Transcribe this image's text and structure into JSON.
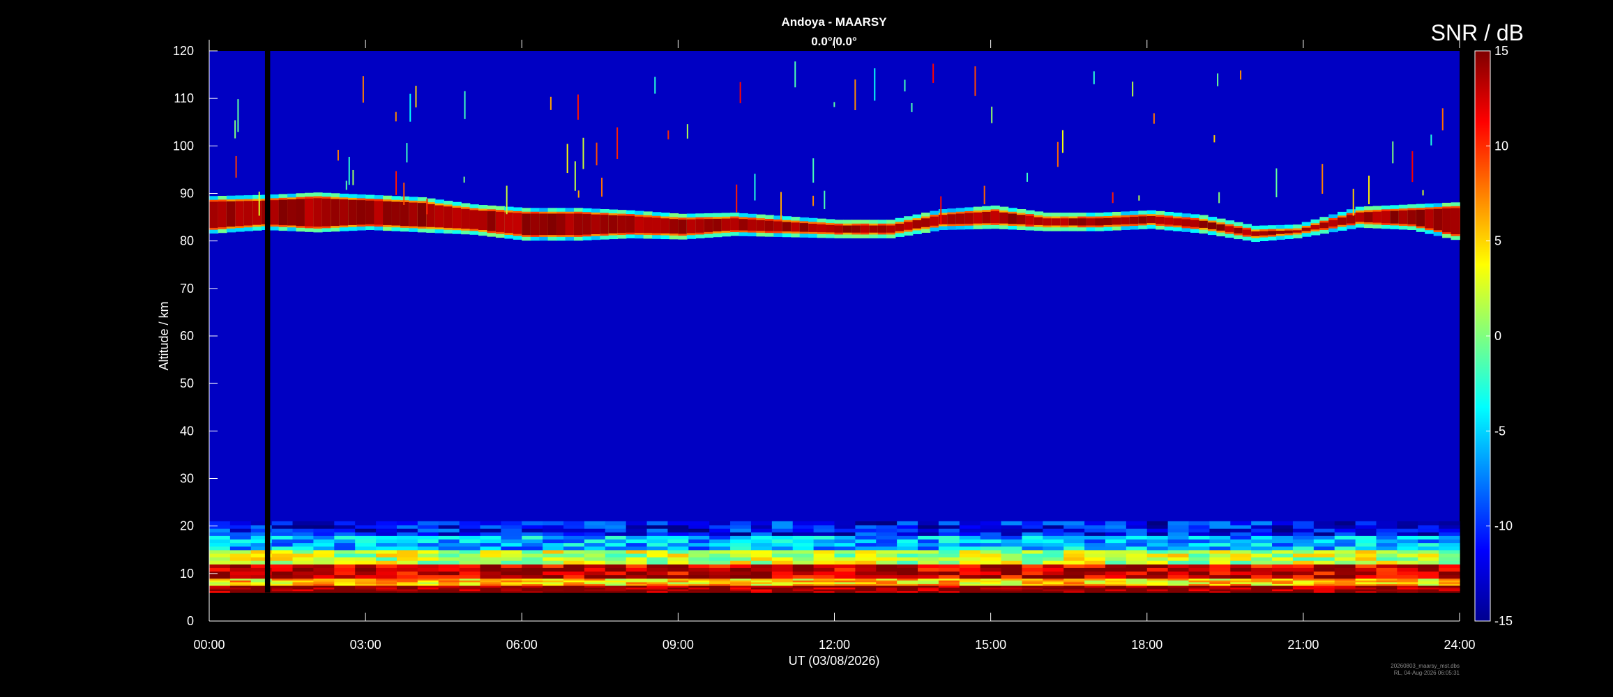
{
  "chart_data": {
    "type": "heatmap",
    "title": "Andoya - MAARSY",
    "subtitle": "0.0°/0.0°",
    "xlabel": "UT (03/08/2026)",
    "ylabel": "Altitude / km",
    "colorbar_label": "SNR / dB",
    "x_ticks": [
      "00:00",
      "03:00",
      "06:00",
      "09:00",
      "12:00",
      "15:00",
      "18:00",
      "21:00",
      "24:00"
    ],
    "x_range_hours": [
      0,
      24
    ],
    "y_ticks": [
      0,
      10,
      20,
      30,
      40,
      50,
      60,
      70,
      80,
      90,
      100,
      110,
      120
    ],
    "ylim": [
      0,
      120
    ],
    "data_altitude_range_km": [
      6,
      120
    ],
    "colorbar_ticks": [
      15,
      10,
      5,
      0,
      -5,
      -10,
      -15
    ],
    "clim": [
      -15,
      15
    ],
    "colormap": "jet",
    "background_snr_db": -13,
    "data_gap": {
      "start_hour": 1.07,
      "end_hour": 1.17
    },
    "features": [
      {
        "name": "PMSE layer",
        "snr_db": 15,
        "segments": [
          {
            "t": 0.0,
            "center_km": 85.5,
            "thickness_km": 5.5
          },
          {
            "t": 1.0,
            "center_km": 86.0,
            "thickness_km": 5.0
          },
          {
            "t": 2.0,
            "center_km": 86.0,
            "thickness_km": 6.0
          },
          {
            "t": 3.0,
            "center_km": 86.0,
            "thickness_km": 5.0
          },
          {
            "t": 4.0,
            "center_km": 85.5,
            "thickness_km": 5.0
          },
          {
            "t": 5.0,
            "center_km": 84.5,
            "thickness_km": 4.0
          },
          {
            "t": 6.0,
            "center_km": 83.5,
            "thickness_km": 4.5
          },
          {
            "t": 7.0,
            "center_km": 83.5,
            "thickness_km": 4.5
          },
          {
            "t": 8.0,
            "center_km": 83.5,
            "thickness_km": 3.5
          },
          {
            "t": 9.0,
            "center_km": 83.0,
            "thickness_km": 3.0
          },
          {
            "t": 10.0,
            "center_km": 83.5,
            "thickness_km": 2.5
          },
          {
            "t": 11.0,
            "center_km": 83.0,
            "thickness_km": 2.0
          },
          {
            "t": 12.0,
            "center_km": 82.5,
            "thickness_km": 1.5
          },
          {
            "t": 13.0,
            "center_km": 82.5,
            "thickness_km": 1.5
          },
          {
            "t": 14.0,
            "center_km": 84.5,
            "thickness_km": 2.0
          },
          {
            "t": 15.0,
            "center_km": 85.0,
            "thickness_km": 2.5
          },
          {
            "t": 16.0,
            "center_km": 84.0,
            "thickness_km": 1.5
          },
          {
            "t": 17.0,
            "center_km": 84.0,
            "thickness_km": 1.5
          },
          {
            "t": 18.0,
            "center_km": 84.5,
            "thickness_km": 1.5
          },
          {
            "t": 19.0,
            "center_km": 83.5,
            "thickness_km": 1.5
          },
          {
            "t": 20.0,
            "center_km": 81.5,
            "thickness_km": 1.0
          },
          {
            "t": 20.8,
            "center_km": 82.0,
            "thickness_km": 0.5
          },
          {
            "t": 22.0,
            "center_km": 85.0,
            "thickness_km": 2.0
          },
          {
            "t": 23.0,
            "center_km": 85.0,
            "thickness_km": 3.0
          },
          {
            "t": 24.0,
            "center_km": 84.0,
            "thickness_km": 6.0
          }
        ]
      },
      {
        "name": "Tropospheric / lower stratospheric echoes",
        "snr_db": 15,
        "altitude_km": [
          6,
          21
        ],
        "layers": [
          {
            "bottom_km": 6.0,
            "top_km": 7.5,
            "snr_db": 15
          },
          {
            "bottom_km": 7.5,
            "top_km": 9.0,
            "snr_db": 5
          },
          {
            "bottom_km": 9.0,
            "top_km": 12.0,
            "snr_db": 13
          },
          {
            "bottom_km": 12.0,
            "top_km": 15.0,
            "snr_db": 2
          },
          {
            "bottom_km": 15.0,
            "top_km": 18.0,
            "snr_db": -6
          },
          {
            "bottom_km": 18.0,
            "top_km": 21.0,
            "snr_db": -11
          }
        ]
      }
    ]
  },
  "footer": {
    "filename": "20260803_maarsy_mst.dbs",
    "created": "RL, 04-Aug-2026 06:05:31"
  }
}
